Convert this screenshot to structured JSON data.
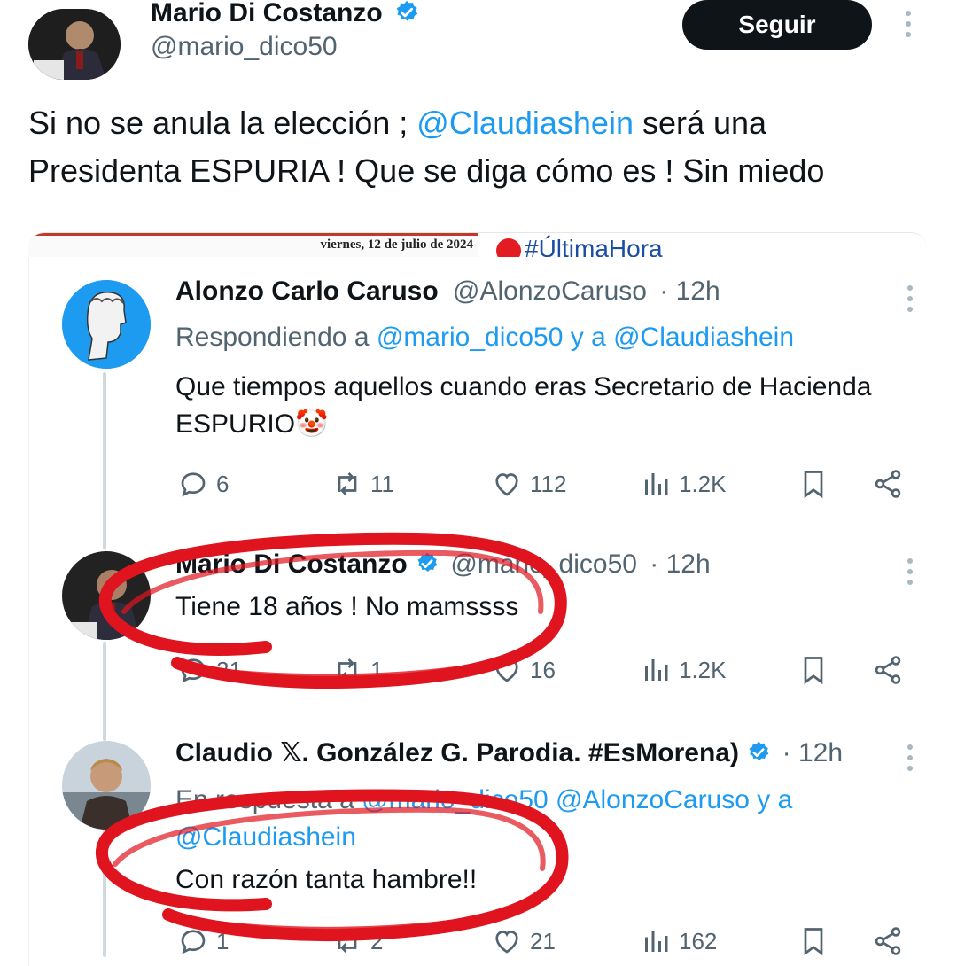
{
  "original_tweet": {
    "author_name": "Mario Di Costanzo",
    "handle": "@mario_dico50",
    "follow_label": "Seguir",
    "text_before": "Si no se anula la elección ; ",
    "mention": "@Claudiashein",
    "text_after": " será una Presidenta ESPURIA ! Que se diga cómo es ! Sin miedo",
    "embed_date": "viernes, 12 de julio de 2024",
    "embed_tag": "#ÚltimaHora"
  },
  "replies": [
    {
      "author_name": "Alonzo Carlo Caruso",
      "handle": "@AlonzoCaruso",
      "time": "· 12h",
      "context_prefix": "Respondiendo a ",
      "context_mentions": "@mario_dico50 y a @Claudiashein",
      "text": "Que tiempos aquellos cuando eras Secretario de Hacienda ESPURIO",
      "emoji": "🤡",
      "stats": {
        "replies": "6",
        "reposts": "11",
        "likes": "112",
        "views": "1.2K"
      }
    },
    {
      "author_name": "Mario Di Costanzo",
      "handle": "@mario_dico50",
      "time": "· 12h",
      "text": "Tiene 18 años ! No mamssss",
      "stats": {
        "replies": "21",
        "reposts": "1",
        "likes": "16",
        "views": "1.2K"
      }
    },
    {
      "author_name": "Claudio 𝕏. González G. Parodia. #EsMorena)",
      "time": "· 12h",
      "context_prefix": "En respuesta a ",
      "context_mentions": "@mario_dico50 @AlonzoCaruso y a",
      "context_mentions_2": "@Claudiashein",
      "text": "Con razón tanta hambre!!",
      "stats": {
        "replies": "1",
        "reposts": "2",
        "likes": "21",
        "views": "162"
      }
    }
  ],
  "colors": {
    "link": "#1d9bf0",
    "muted": "#536471",
    "verified": "#1d9bf0",
    "annotation": "#e0141e"
  },
  "icons": [
    "reply-icon",
    "repost-icon",
    "like-icon",
    "views-icon",
    "bookmark-icon",
    "share-icon",
    "verified-icon",
    "more-icon"
  ]
}
